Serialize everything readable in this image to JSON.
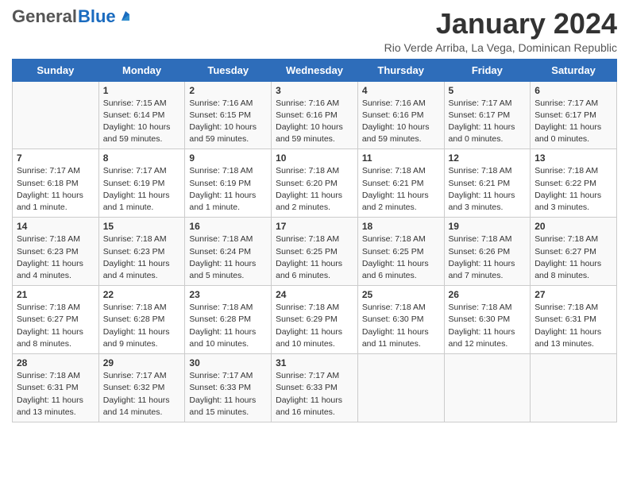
{
  "logo": {
    "general": "General",
    "blue": "Blue"
  },
  "header": {
    "title": "January 2024",
    "subtitle": "Rio Verde Arriba, La Vega, Dominican Republic"
  },
  "weekdays": [
    "Sunday",
    "Monday",
    "Tuesday",
    "Wednesday",
    "Thursday",
    "Friday",
    "Saturday"
  ],
  "weeks": [
    [
      {
        "day": "",
        "sunrise": "",
        "sunset": "",
        "daylight": ""
      },
      {
        "day": "1",
        "sunrise": "Sunrise: 7:15 AM",
        "sunset": "Sunset: 6:14 PM",
        "daylight": "Daylight: 10 hours and 59 minutes."
      },
      {
        "day": "2",
        "sunrise": "Sunrise: 7:16 AM",
        "sunset": "Sunset: 6:15 PM",
        "daylight": "Daylight: 10 hours and 59 minutes."
      },
      {
        "day": "3",
        "sunrise": "Sunrise: 7:16 AM",
        "sunset": "Sunset: 6:16 PM",
        "daylight": "Daylight: 10 hours and 59 minutes."
      },
      {
        "day": "4",
        "sunrise": "Sunrise: 7:16 AM",
        "sunset": "Sunset: 6:16 PM",
        "daylight": "Daylight: 10 hours and 59 minutes."
      },
      {
        "day": "5",
        "sunrise": "Sunrise: 7:17 AM",
        "sunset": "Sunset: 6:17 PM",
        "daylight": "Daylight: 11 hours and 0 minutes."
      },
      {
        "day": "6",
        "sunrise": "Sunrise: 7:17 AM",
        "sunset": "Sunset: 6:17 PM",
        "daylight": "Daylight: 11 hours and 0 minutes."
      }
    ],
    [
      {
        "day": "7",
        "sunrise": "Sunrise: 7:17 AM",
        "sunset": "Sunset: 6:18 PM",
        "daylight": "Daylight: 11 hours and 1 minute."
      },
      {
        "day": "8",
        "sunrise": "Sunrise: 7:17 AM",
        "sunset": "Sunset: 6:19 PM",
        "daylight": "Daylight: 11 hours and 1 minute."
      },
      {
        "day": "9",
        "sunrise": "Sunrise: 7:18 AM",
        "sunset": "Sunset: 6:19 PM",
        "daylight": "Daylight: 11 hours and 1 minute."
      },
      {
        "day": "10",
        "sunrise": "Sunrise: 7:18 AM",
        "sunset": "Sunset: 6:20 PM",
        "daylight": "Daylight: 11 hours and 2 minutes."
      },
      {
        "day": "11",
        "sunrise": "Sunrise: 7:18 AM",
        "sunset": "Sunset: 6:21 PM",
        "daylight": "Daylight: 11 hours and 2 minutes."
      },
      {
        "day": "12",
        "sunrise": "Sunrise: 7:18 AM",
        "sunset": "Sunset: 6:21 PM",
        "daylight": "Daylight: 11 hours and 3 minutes."
      },
      {
        "day": "13",
        "sunrise": "Sunrise: 7:18 AM",
        "sunset": "Sunset: 6:22 PM",
        "daylight": "Daylight: 11 hours and 3 minutes."
      }
    ],
    [
      {
        "day": "14",
        "sunrise": "Sunrise: 7:18 AM",
        "sunset": "Sunset: 6:23 PM",
        "daylight": "Daylight: 11 hours and 4 minutes."
      },
      {
        "day": "15",
        "sunrise": "Sunrise: 7:18 AM",
        "sunset": "Sunset: 6:23 PM",
        "daylight": "Daylight: 11 hours and 4 minutes."
      },
      {
        "day": "16",
        "sunrise": "Sunrise: 7:18 AM",
        "sunset": "Sunset: 6:24 PM",
        "daylight": "Daylight: 11 hours and 5 minutes."
      },
      {
        "day": "17",
        "sunrise": "Sunrise: 7:18 AM",
        "sunset": "Sunset: 6:25 PM",
        "daylight": "Daylight: 11 hours and 6 minutes."
      },
      {
        "day": "18",
        "sunrise": "Sunrise: 7:18 AM",
        "sunset": "Sunset: 6:25 PM",
        "daylight": "Daylight: 11 hours and 6 minutes."
      },
      {
        "day": "19",
        "sunrise": "Sunrise: 7:18 AM",
        "sunset": "Sunset: 6:26 PM",
        "daylight": "Daylight: 11 hours and 7 minutes."
      },
      {
        "day": "20",
        "sunrise": "Sunrise: 7:18 AM",
        "sunset": "Sunset: 6:27 PM",
        "daylight": "Daylight: 11 hours and 8 minutes."
      }
    ],
    [
      {
        "day": "21",
        "sunrise": "Sunrise: 7:18 AM",
        "sunset": "Sunset: 6:27 PM",
        "daylight": "Daylight: 11 hours and 8 minutes."
      },
      {
        "day": "22",
        "sunrise": "Sunrise: 7:18 AM",
        "sunset": "Sunset: 6:28 PM",
        "daylight": "Daylight: 11 hours and 9 minutes."
      },
      {
        "day": "23",
        "sunrise": "Sunrise: 7:18 AM",
        "sunset": "Sunset: 6:28 PM",
        "daylight": "Daylight: 11 hours and 10 minutes."
      },
      {
        "day": "24",
        "sunrise": "Sunrise: 7:18 AM",
        "sunset": "Sunset: 6:29 PM",
        "daylight": "Daylight: 11 hours and 10 minutes."
      },
      {
        "day": "25",
        "sunrise": "Sunrise: 7:18 AM",
        "sunset": "Sunset: 6:30 PM",
        "daylight": "Daylight: 11 hours and 11 minutes."
      },
      {
        "day": "26",
        "sunrise": "Sunrise: 7:18 AM",
        "sunset": "Sunset: 6:30 PM",
        "daylight": "Daylight: 11 hours and 12 minutes."
      },
      {
        "day": "27",
        "sunrise": "Sunrise: 7:18 AM",
        "sunset": "Sunset: 6:31 PM",
        "daylight": "Daylight: 11 hours and 13 minutes."
      }
    ],
    [
      {
        "day": "28",
        "sunrise": "Sunrise: 7:18 AM",
        "sunset": "Sunset: 6:31 PM",
        "daylight": "Daylight: 11 hours and 13 minutes."
      },
      {
        "day": "29",
        "sunrise": "Sunrise: 7:17 AM",
        "sunset": "Sunset: 6:32 PM",
        "daylight": "Daylight: 11 hours and 14 minutes."
      },
      {
        "day": "30",
        "sunrise": "Sunrise: 7:17 AM",
        "sunset": "Sunset: 6:33 PM",
        "daylight": "Daylight: 11 hours and 15 minutes."
      },
      {
        "day": "31",
        "sunrise": "Sunrise: 7:17 AM",
        "sunset": "Sunset: 6:33 PM",
        "daylight": "Daylight: 11 hours and 16 minutes."
      },
      {
        "day": "",
        "sunrise": "",
        "sunset": "",
        "daylight": ""
      },
      {
        "day": "",
        "sunrise": "",
        "sunset": "",
        "daylight": ""
      },
      {
        "day": "",
        "sunrise": "",
        "sunset": "",
        "daylight": ""
      }
    ]
  ]
}
